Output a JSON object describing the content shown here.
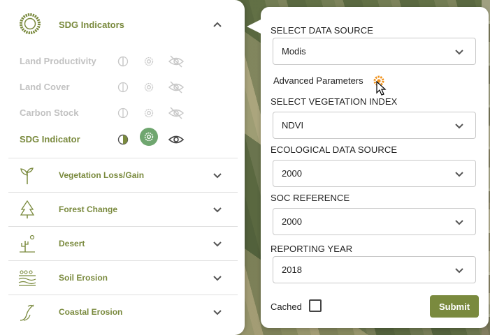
{
  "sidebar": {
    "header": {
      "title": "SDG Indicators",
      "icon": "sdg-wheel-icon"
    },
    "sub_items": [
      {
        "label": "Land Productivity",
        "active": false
      },
      {
        "label": "Land Cover",
        "active": false
      },
      {
        "label": "Carbon Stock",
        "active": false
      },
      {
        "label": "SDG Indicator",
        "active": true
      }
    ],
    "categories": [
      {
        "label": "Vegetation Loss/Gain",
        "icon": "sprout-icon"
      },
      {
        "label": "Forest Change",
        "icon": "tree-icon"
      },
      {
        "label": "Desert",
        "icon": "cactus-sun-icon"
      },
      {
        "label": "Soil Erosion",
        "icon": "soil-layers-icon"
      },
      {
        "label": "Coastal Erosion",
        "icon": "coast-wave-icon"
      }
    ],
    "accent_color": "#7a8a3e",
    "inactive_color": "#c2c2c2",
    "active_gear_color": "#6fa66f"
  },
  "form": {
    "data_source": {
      "label": "SELECT DATA SOURCE",
      "value": "Modis"
    },
    "advanced": {
      "label": "Advanced Parameters",
      "icon_color": "#f0931e"
    },
    "vegetation_index": {
      "label": "SELECT VEGETATION INDEX",
      "value": "NDVI"
    },
    "ecological_source": {
      "label": "ECOLOGICAL DATA SOURCE",
      "value": "2000"
    },
    "soc_reference": {
      "label": "SOC REFERENCE",
      "value": "2000"
    },
    "reporting_year": {
      "label": "REPORTING YEAR",
      "value": "2018"
    },
    "cached": {
      "label": "Cached",
      "checked": false
    },
    "submit_label": "Submit"
  }
}
